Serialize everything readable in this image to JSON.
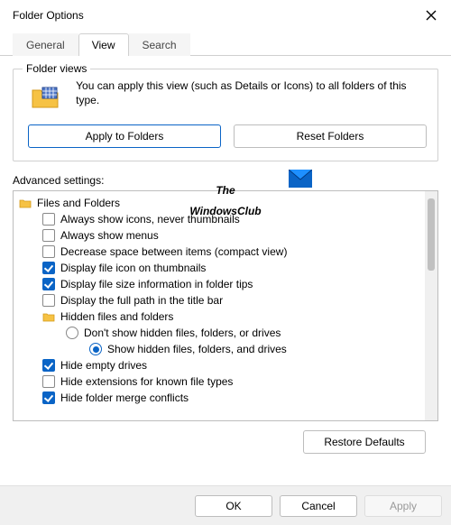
{
  "window": {
    "title": "Folder Options"
  },
  "tabs": {
    "general": "General",
    "view": "View",
    "search": "Search"
  },
  "folderViews": {
    "groupTitle": "Folder views",
    "desc": "You can apply this view (such as Details or Icons) to all folders of this type.",
    "applyBtn": "Apply to Folders",
    "resetBtn": "Reset Folders"
  },
  "advLabel": "Advanced settings:",
  "tree": {
    "root": "Files and Folders",
    "items": [
      {
        "type": "cb",
        "checked": false,
        "label": "Always show icons, never thumbnails"
      },
      {
        "type": "cb",
        "checked": false,
        "label": "Always show menus"
      },
      {
        "type": "cb",
        "checked": false,
        "label": "Decrease space between items (compact view)"
      },
      {
        "type": "cb",
        "checked": true,
        "label": "Display file icon on thumbnails"
      },
      {
        "type": "cb",
        "checked": true,
        "label": "Display file size information in folder tips"
      },
      {
        "type": "cb",
        "checked": false,
        "label": "Display the full path in the title bar"
      }
    ],
    "hiddenGroup": "Hidden files and folders",
    "radios": [
      {
        "checked": false,
        "label": "Don't show hidden files, folders, or drives"
      },
      {
        "checked": true,
        "label": "Show hidden files, folders, and drives"
      }
    ],
    "tail": [
      {
        "type": "cb",
        "checked": true,
        "label": "Hide empty drives"
      },
      {
        "type": "cb",
        "checked": false,
        "label": "Hide extensions for known file types"
      },
      {
        "type": "cb",
        "checked": true,
        "label": "Hide folder merge conflicts"
      }
    ]
  },
  "restoreBtn": "Restore Defaults",
  "footer": {
    "ok": "OK",
    "cancel": "Cancel",
    "apply": "Apply"
  },
  "watermark": {
    "line1": "The",
    "line2": "WindowsClub"
  }
}
